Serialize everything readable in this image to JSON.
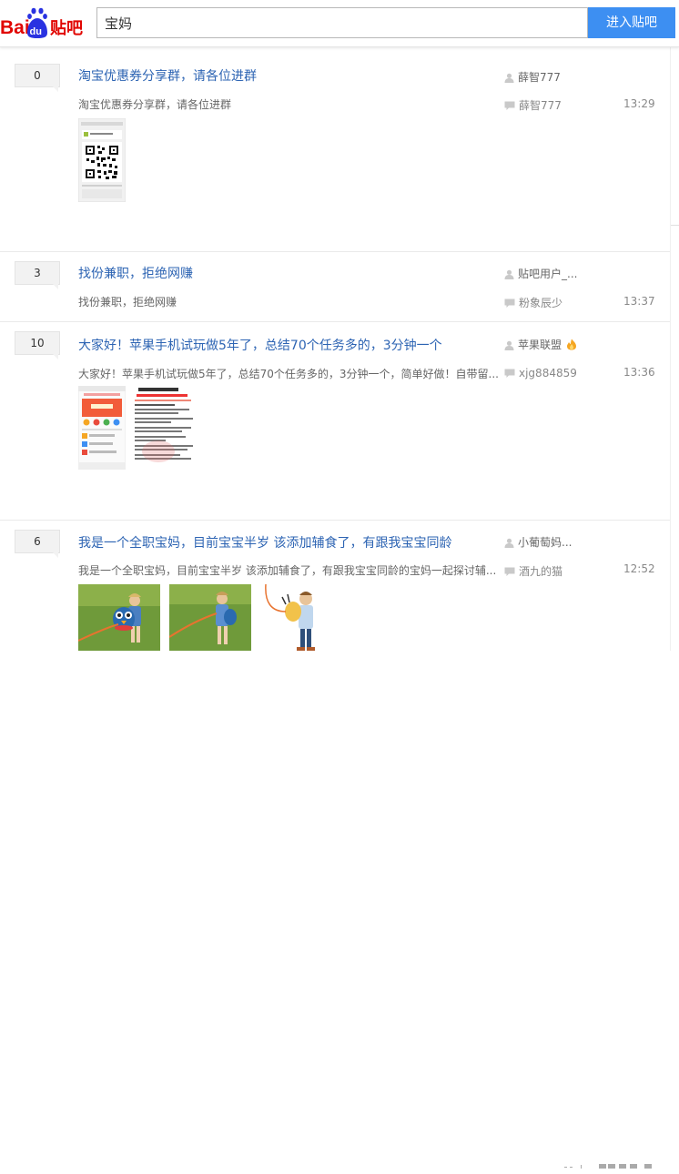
{
  "logo": {
    "text_left": "Bai",
    "text_badge": "du",
    "text_right": "贴吧"
  },
  "search": {
    "value": "宝妈",
    "button_label": "进入贴吧"
  },
  "threads": [
    {
      "reply_count": "0",
      "title": "淘宝优惠券分享群，请各位进群",
      "abstract": "淘宝优惠券分享群，请各位进群",
      "author": "薛智777",
      "last_reply_user": "薛智777",
      "last_reply_time": "13:29"
    },
    {
      "reply_count": "3",
      "title": "找份兼职，拒绝网赚",
      "abstract": "找份兼职，拒绝网赚",
      "author": "贴吧用户_...",
      "last_reply_user": "粉象辰少",
      "last_reply_time": "13:37"
    },
    {
      "reply_count": "10",
      "title": "大家好！苹果手机试玩做5年了，总结70个任务多的，3分钟一个",
      "abstract": "大家好！苹果手机试玩做5年了，总结70个任务多的，3分钟一个，简单好做！自带留...",
      "author": "苹果联盟",
      "last_reply_user": "xjg884859",
      "last_reply_time": "13:36"
    },
    {
      "reply_count": "6",
      "title": "我是一个全职宝妈，目前宝宝半岁 该添加辅食了，有跟我宝宝同龄",
      "abstract": "我是一个全职宝妈，目前宝宝半岁 该添加辅食了，有跟我宝宝同龄的宝妈一起探讨辅...",
      "author": "小葡萄妈...",
      "last_reply_user": "酒九的猫",
      "last_reply_time": "12:52"
    }
  ],
  "icons": {
    "author": "user-icon",
    "reply": "comment-icon",
    "badge": "flame-icon"
  },
  "colors": {
    "accent": "#3d8ff2",
    "title_link": "#2d64b3",
    "logo_red": "#e10602",
    "logo_blue": "#2932e1"
  }
}
